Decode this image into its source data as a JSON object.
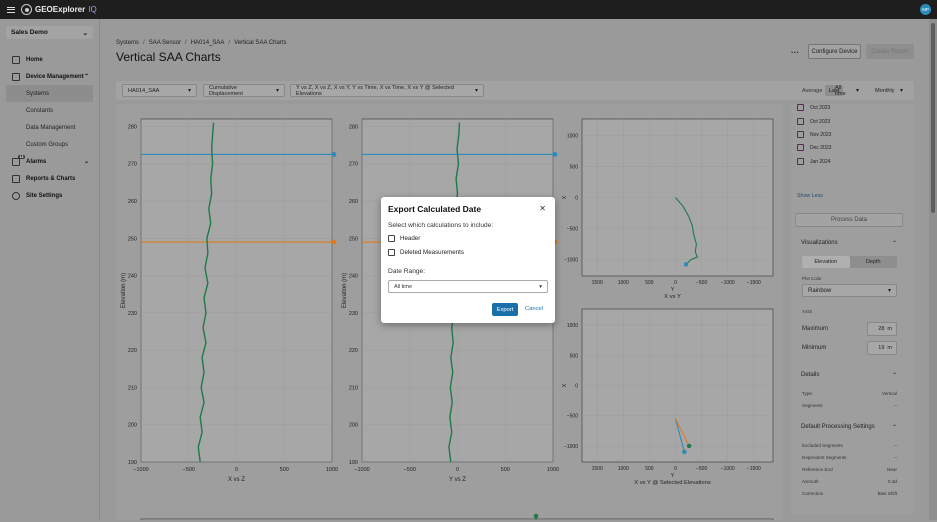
{
  "app": {
    "brand": "GEOExplorer",
    "brand_suffix": "IQ",
    "avatar_initials": "MP"
  },
  "sidebar": {
    "org": "Sales Demo",
    "items": [
      {
        "label": "Home",
        "icon": "home-icon"
      },
      {
        "label": "Device Management",
        "icon": "device-icon"
      },
      {
        "label": "Alarms",
        "icon": "bell-icon",
        "badge": "13"
      },
      {
        "label": "Reports & Charts",
        "icon": "report-icon"
      },
      {
        "label": "Site Settings",
        "icon": "gear-icon"
      }
    ],
    "sub_items": [
      "Systems",
      "Constants",
      "Data Management",
      "Custom Groups"
    ]
  },
  "header": {
    "breadcrumb": [
      "Systems",
      "SAA Sensor",
      "HA014_SAA",
      "Vertical SAA Charts"
    ],
    "title": "Vertical SAA Charts",
    "configure_label": "Configure Device",
    "report_label": "Create Report"
  },
  "filters": {
    "device": "HA014_SAA",
    "calc": "Cumulative Displacement",
    "plots": "Y vs Z, X vs Z, X vs Y, Y vs Time, X vs Time, X vs Y @ Selected Elevations",
    "average_label": "Average",
    "average_seg": "Last",
    "time": "All time",
    "interval": "Monthly"
  },
  "chart_data": [
    {
      "type": "line",
      "title": "",
      "xlabel": "X vs Z",
      "ylabel": "Elevation (m)",
      "xlim": [
        -1000,
        1000
      ],
      "ylim": [
        190,
        282
      ],
      "xticks": [
        "−1000",
        "−500",
        "0",
        "500",
        "1000"
      ],
      "yticks": [
        190,
        200,
        210,
        220,
        230,
        240,
        250,
        260,
        270,
        280
      ],
      "series": [
        {
          "points": [
            [
              -380,
              190
            ],
            [
              -400,
              194
            ],
            [
              -360,
              198
            ],
            [
              -380,
              202
            ],
            [
              -340,
              206
            ],
            [
              -370,
              210
            ],
            [
              -340,
              214
            ],
            [
              -360,
              218
            ],
            [
              -320,
              222
            ],
            [
              -350,
              226
            ],
            [
              -320,
              230
            ],
            [
              -340,
              234
            ],
            [
              -300,
              238
            ],
            [
              -330,
              242
            ],
            [
              -300,
              246
            ],
            [
              -310,
              250
            ],
            [
              -270,
              254
            ],
            [
              -290,
              258
            ],
            [
              -260,
              262
            ],
            [
              -270,
              266
            ],
            [
              -250,
              270
            ],
            [
              -260,
              274
            ],
            [
              -250,
              278
            ],
            [
              -240,
              281
            ]
          ]
        }
      ],
      "markers": [
        272.5,
        249
      ]
    },
    {
      "type": "line",
      "title": "",
      "xlabel": "Y vs Z",
      "ylabel": "Elevation (m)",
      "xlim": [
        -1000,
        1000
      ],
      "ylim": [
        190,
        282
      ],
      "xticks": [
        "−1000",
        "−500",
        "0",
        "500",
        "1000"
      ],
      "yticks": [
        190,
        200,
        210,
        220,
        230,
        240,
        250,
        260,
        270,
        280
      ],
      "series": [
        {
          "points": [
            [
              -70,
              190
            ],
            [
              -90,
              194
            ],
            [
              -60,
              198
            ],
            [
              -80,
              202
            ],
            [
              -55,
              206
            ],
            [
              -75,
              210
            ],
            [
              -50,
              214
            ],
            [
              -70,
              218
            ],
            [
              -45,
              222
            ],
            [
              -60,
              226
            ],
            [
              -40,
              230
            ],
            [
              -55,
              234
            ],
            [
              -30,
              238
            ],
            [
              -50,
              242
            ],
            [
              -20,
              246
            ],
            [
              -35,
              250
            ],
            [
              -10,
              254
            ],
            [
              -25,
              258
            ],
            [
              0,
              262
            ],
            [
              -15,
              266
            ],
            [
              10,
              270
            ],
            [
              -5,
              274
            ],
            [
              15,
              278
            ],
            [
              20,
              281
            ]
          ]
        }
      ],
      "markers": [
        272.5,
        249
      ]
    },
    {
      "type": "line",
      "title": "",
      "xlabel": "X vs Y",
      "ylabel": "X",
      "xlim_label": "Y",
      "xticks": [
        "1500",
        "1000",
        "500",
        "0",
        "−500",
        "−1000",
        "−1500"
      ],
      "yticks": [
        "1000",
        "500",
        "0",
        "−500",
        "−1000"
      ],
      "series": [
        {
          "points": [
            [
              0,
              0
            ],
            [
              -150,
              -150
            ],
            [
              -250,
              -300
            ],
            [
              -320,
              -450
            ],
            [
              -350,
              -600
            ],
            [
              -400,
              -750
            ],
            [
              -380,
              -880
            ],
            [
              -420,
              -960
            ],
            [
              -300,
              -1000
            ],
            [
              -200,
              -1080
            ]
          ]
        }
      ]
    },
    {
      "type": "line",
      "title": "",
      "xlabel": "X vs Y @ Selected Elevations",
      "ylabel": "X",
      "xlim_label": "Y",
      "xticks": [
        "1500",
        "1000",
        "500",
        "0",
        "−500",
        "−1000",
        "−1500"
      ],
      "yticks": [
        "1000",
        "500",
        "0",
        "−500",
        "−1000"
      ],
      "series": [
        {
          "color": "#2b8cba",
          "points": [
            [
              0,
              -550
            ],
            [
              -170,
              -1100
            ]
          ]
        },
        {
          "color": "#e07b1a",
          "points": [
            [
              0,
              -550
            ],
            [
              -260,
              -1000
            ]
          ]
        }
      ]
    }
  ],
  "right_panel": {
    "months": [
      "Oct 2023",
      "Nov 2023",
      "Dec 2023",
      "Jan 2024"
    ],
    "show_less": "Show Less",
    "process": "Process Data",
    "visualizations": "Visualizations",
    "toggle": [
      "Elevation",
      "Depth"
    ],
    "plot_color_label": "Plot Color",
    "plot_color": "Rainbow",
    "axis_label": "AXIS",
    "maximum_label": "Maximum",
    "maximum_value": "28",
    "minimum_label": "Minimum",
    "minimum_value": "19",
    "unit": "m",
    "details": "Details",
    "type_label": "Type",
    "type_value": "Vertical",
    "segments_label": "Segments",
    "segments_value": "--",
    "dps": "Default Processing Settings",
    "excluded_label": "Excluded Segments",
    "excluded_value": "--",
    "dependent_label": "Dependent Segments",
    "dependent_value": "--",
    "ref_label": "Reference End",
    "ref_value": "Near",
    "azimuth_label": "Azimuth",
    "azimuth_value": "0 dd",
    "correction_label": "Correction",
    "correction_value": "Bias Shift"
  },
  "modal": {
    "title": "Export Calculated Date",
    "question": "Select which calculations to include:",
    "options": [
      "Header",
      "Deleted Measurements"
    ],
    "date_range_label": "Date Range:",
    "date_range_value": "All time",
    "export_label": "Export",
    "cancel_label": "Cancel"
  },
  "colors": {
    "line_green": "#1e7a4a",
    "marker_blue": "#2b8cba",
    "marker_orange": "#e07b1a",
    "accent": "#1a6fa8"
  }
}
